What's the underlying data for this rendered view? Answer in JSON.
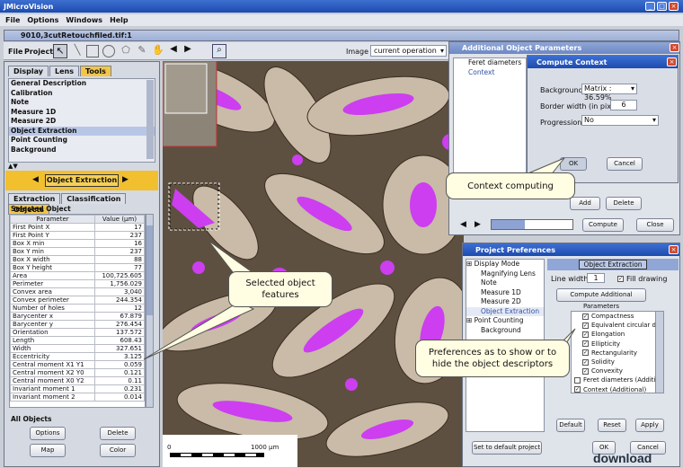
{
  "app": {
    "title": "JMicroVision",
    "menus": [
      "File",
      "Options",
      "Windows",
      "Help"
    ]
  },
  "doc": {
    "title": "9010,3cutRetouchfiled.tif:1"
  },
  "toolbar": {
    "menus": [
      "File",
      "Project"
    ],
    "image_label": "Image :",
    "image_value": "current operation"
  },
  "left": {
    "tabs": [
      "Display",
      "Lens",
      "Tools"
    ],
    "tools": [
      "General Description",
      "Calibration",
      "Note",
      "Measure 1D",
      "Measure 2D",
      "Object Extraction",
      "Point Counting",
      "Background"
    ],
    "header": "Object Extraction",
    "subtabs": [
      "Extraction",
      "Classification",
      "Objects"
    ],
    "selected_object": "Selected Object",
    "col_param": "Parameter",
    "col_value": "Value (µm)",
    "rows": [
      [
        "First Point X",
        "17"
      ],
      [
        "First Point Y",
        "237"
      ],
      [
        "Box X min",
        "16"
      ],
      [
        "Box Y min",
        "237"
      ],
      [
        "Box X width",
        "88"
      ],
      [
        "Box Y height",
        "77"
      ],
      [
        "Area",
        "100,725.605"
      ],
      [
        "Perimeter",
        "1,756.029"
      ],
      [
        "Convex area",
        "3,040"
      ],
      [
        "Convex perimeter",
        "244.354"
      ],
      [
        "Number of holes",
        "12"
      ],
      [
        "Barycenter x",
        "67.879"
      ],
      [
        "Barycenter y",
        "276.454"
      ],
      [
        "Orientation",
        "137.572"
      ],
      [
        "Length",
        "608.43"
      ],
      [
        "Width",
        "327.651"
      ],
      [
        "Eccentricity",
        "3.125"
      ],
      [
        "Central moment X1 Y1",
        "0.059"
      ],
      [
        "Central moment X2 Y0",
        "0.121"
      ],
      [
        "Central moment X0 Y2",
        "0.11"
      ],
      [
        "Invariant moment 1",
        "0.231"
      ],
      [
        "Invariant moment 2",
        "0.014"
      ]
    ],
    "all_objects": "All Objects",
    "buttons": [
      "Options",
      "Delete",
      "Map",
      "Color"
    ]
  },
  "scale": {
    "zero": "0",
    "label": "1000 µm"
  },
  "additional": {
    "title": "Additional Object Parameters",
    "items": [
      "Feret diameters",
      "Context"
    ],
    "add": "Add",
    "delete": "Delete",
    "progress": "41%",
    "compute": "Compute",
    "close": "Close"
  },
  "context": {
    "title": "Compute Context",
    "background_label": "Background :",
    "background_value": "Matrix : 36.59%",
    "border_label": "Border width (in pixel)",
    "border_value": "6",
    "progression_label": "Progression :",
    "progression_value": "No",
    "ok": "OK",
    "cancel": "Cancel"
  },
  "prefs": {
    "title": "Project Preferences",
    "tree": [
      "Display Mode",
      "Magnifying Lens",
      "Note",
      "Measure 1D",
      "Measure 2D",
      "Object Extraction",
      "Point Counting",
      "Background"
    ],
    "group": "Object Extraction",
    "line_width_label": "Line width",
    "line_width_value": "1",
    "fill_label": "Fill drawing",
    "compute_btn": "Compute Additional Parameters",
    "checks": [
      "Compactness",
      "Equivalent circular diamet",
      "Elongation",
      "Ellipticity",
      "Rectangularity",
      "Solidity",
      "Convexity",
      "Feret diameters (Additional)",
      "Context (Additional)"
    ],
    "default": "Default",
    "reset": "Reset",
    "apply": "Apply",
    "set_default": "Set to default project",
    "ok": "OK",
    "cancel": "Cancel"
  },
  "callouts": {
    "context": "Context computing",
    "selected": "Selected object features",
    "prefs": "Preferences as to show or to hide the object descriptors"
  },
  "watermark": "download"
}
